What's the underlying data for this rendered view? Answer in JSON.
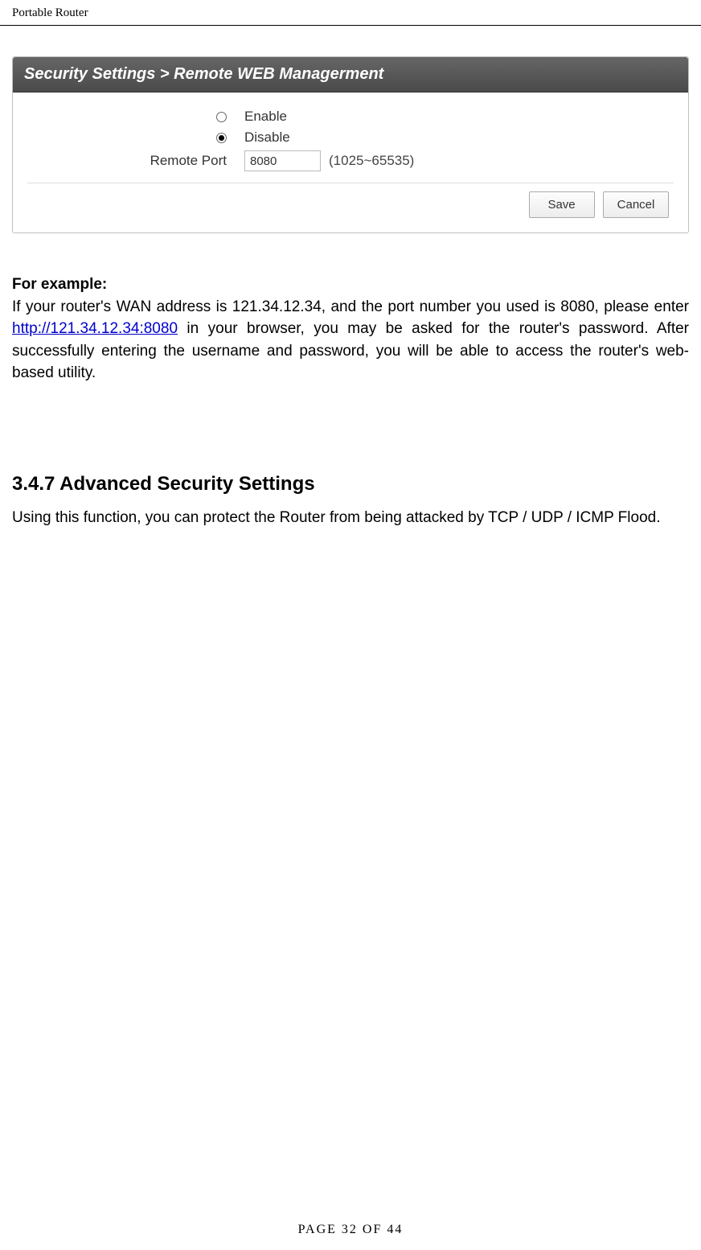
{
  "header": {
    "title": "Portable Router"
  },
  "panel": {
    "breadcrumb": "Security Settings > Remote WEB Managerment",
    "enable_label": "Enable",
    "disable_label": "Disable",
    "port_label": "Remote Port",
    "port_value": "8080",
    "port_hint": "(1025~65535)",
    "save_label": "Save",
    "cancel_label": "Cancel"
  },
  "example": {
    "heading": "For example:",
    "text_before_link": "If your router's WAN address is 121.34.12.34, and the port number you used is 8080, please enter ",
    "link_text": "http://121.34.12.34:8080",
    "text_after_link": " in your browser, you may be asked for the router's password. After successfully entering the username and password, you will be able to access the router's web-based utility."
  },
  "section": {
    "heading": "3.4.7 Advanced Security Settings",
    "body": "Using this function, you can protect the Router from being attacked by TCP / UDP / ICMP Flood."
  },
  "footer": {
    "text": "PAGE  32  OF  44"
  }
}
